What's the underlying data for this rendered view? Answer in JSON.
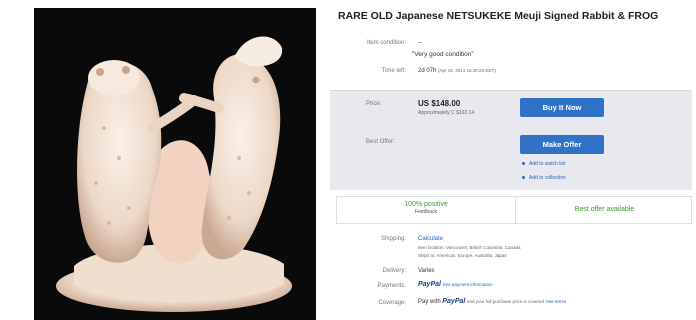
{
  "listing": {
    "title": "RARE OLD Japanese NETSUKEKE Meuji Signed Rabbit & FROG",
    "condition_label": "Item condition:",
    "condition_value": "--",
    "condition_note": "\"Very good condition\"",
    "time_left_label": "Time left:",
    "time_left_value": "2d 07h",
    "time_left_date": "(Apr 18, 2014  15:40:29 EDT)"
  },
  "price_box": {
    "price_label": "Price:",
    "price": "US $148.00",
    "approx": "Approximately C $163.14",
    "buy_now": "Buy It Now",
    "best_offer_label": "Best Offer:",
    "make_offer": "Make Offer",
    "add_watch": "Add to watch list",
    "add_collection": "Add to collection"
  },
  "feedback": {
    "positive": "100% positive",
    "feedback_label": "Feedback",
    "best_offer_available": "Best offer available"
  },
  "details": {
    "shipping_label": "Shipping:",
    "shipping_value": "Calculate",
    "item_location": "Item location:  Vancouver, British Columbia, Canada",
    "ships_to": "Ships to:  Americas, Europe, Australia, Japan",
    "delivery_label": "Delivery:",
    "delivery_value": "Varies",
    "payments_label": "Payments:",
    "payments_paypal": "PayPal",
    "payments_link": "See payment information",
    "coverage_label": "Coverage:",
    "coverage_text": "Pay with",
    "coverage_paypal": "PayPal",
    "coverage_tail": "and your full purchase price is covered",
    "coverage_link": "See terms"
  },
  "colors": {
    "button_blue": "#2f73c9",
    "positive_green": "#3a9a2e",
    "link_blue": "#2a63b8"
  },
  "icons": {
    "watch": "dot-bullet-icon",
    "collection": "dot-bullet-icon"
  }
}
